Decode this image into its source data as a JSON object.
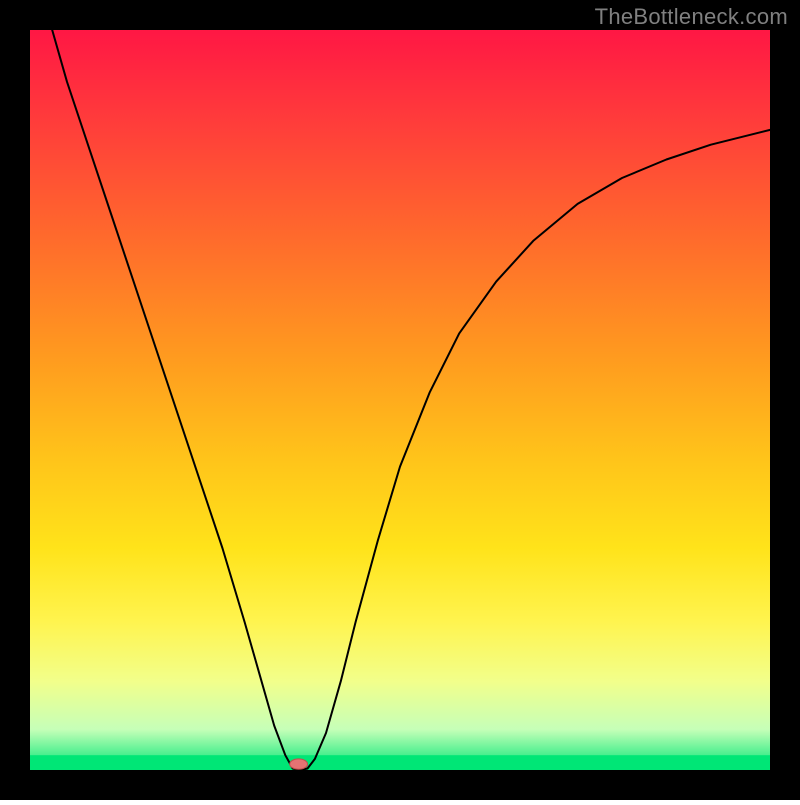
{
  "watermark": "TheBottleneck.com",
  "chart_data": {
    "type": "line",
    "title": "",
    "xlabel": "",
    "ylabel": "",
    "xlim": [
      0,
      100
    ],
    "ylim": [
      0,
      100
    ],
    "background_gradient_colors": [
      "#ff1744",
      "#ff3b3b",
      "#ff6a2c",
      "#ff9a1f",
      "#ffc41a",
      "#ffe31a",
      "#fff44f",
      "#f2ff8b",
      "#c6ffb8",
      "#00e676"
    ],
    "frame_color": "#000000",
    "frame_thickness_px": 30,
    "series": [
      {
        "name": "bottleneck-curve",
        "stroke": "#000000",
        "stroke_width": 2,
        "data": [
          {
            "x": 3.0,
            "y": 100.0
          },
          {
            "x": 5.0,
            "y": 93.0
          },
          {
            "x": 8.0,
            "y": 84.0
          },
          {
            "x": 11.0,
            "y": 75.0
          },
          {
            "x": 14.0,
            "y": 66.0
          },
          {
            "x": 17.0,
            "y": 57.0
          },
          {
            "x": 20.0,
            "y": 48.0
          },
          {
            "x": 23.0,
            "y": 39.0
          },
          {
            "x": 26.0,
            "y": 30.0
          },
          {
            "x": 29.0,
            "y": 20.0
          },
          {
            "x": 31.0,
            "y": 13.0
          },
          {
            "x": 33.0,
            "y": 6.0
          },
          {
            "x": 34.5,
            "y": 2.0
          },
          {
            "x": 35.5,
            "y": 0.2
          },
          {
            "x": 36.5,
            "y": 0.0
          },
          {
            "x": 37.5,
            "y": 0.2
          },
          {
            "x": 38.5,
            "y": 1.5
          },
          {
            "x": 40.0,
            "y": 5.0
          },
          {
            "x": 42.0,
            "y": 12.0
          },
          {
            "x": 44.0,
            "y": 20.0
          },
          {
            "x": 47.0,
            "y": 31.0
          },
          {
            "x": 50.0,
            "y": 41.0
          },
          {
            "x": 54.0,
            "y": 51.0
          },
          {
            "x": 58.0,
            "y": 59.0
          },
          {
            "x": 63.0,
            "y": 66.0
          },
          {
            "x": 68.0,
            "y": 71.5
          },
          {
            "x": 74.0,
            "y": 76.5
          },
          {
            "x": 80.0,
            "y": 80.0
          },
          {
            "x": 86.0,
            "y": 82.5
          },
          {
            "x": 92.0,
            "y": 84.5
          },
          {
            "x": 100.0,
            "y": 86.5
          }
        ]
      }
    ],
    "markers": [
      {
        "name": "optimal-point",
        "x": 36.3,
        "y": 0.8,
        "shape": "ellipse",
        "rx": 1.2,
        "ry": 0.7,
        "fill": "#e57373",
        "stroke": "#c0504d"
      }
    ]
  }
}
